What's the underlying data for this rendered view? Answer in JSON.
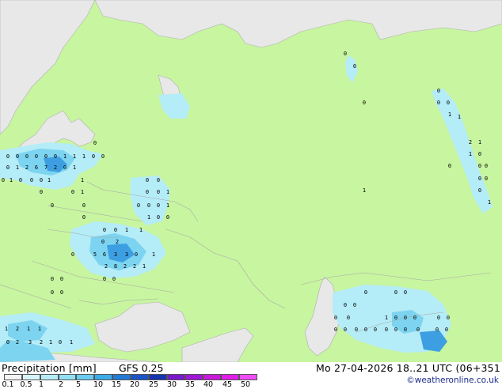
{
  "footer": {
    "title": "Precipitation [mm]",
    "model": "GFS 0.25",
    "valid": "Mo 27-04-2026 18..21 UTC (06+351",
    "credit": "©weatheronline.co.uk"
  },
  "legend": {
    "labels": [
      "0.1",
      "0.5",
      "1",
      "2",
      "5",
      "10",
      "15",
      "20",
      "25",
      "30",
      "35",
      "40",
      "45",
      "50"
    ],
    "colors": [
      "#f5f5f5",
      "#d8f6fa",
      "#b6ecf6",
      "#93e0f4",
      "#6ccdf0",
      "#3dabe6",
      "#247bd6",
      "#1a55c6",
      "#1635ae",
      "#7a19c9",
      "#9f18d8",
      "#c81ad8",
      "#e01ee8",
      "#f04cf5"
    ]
  },
  "colors": {
    "land": "#c8f5a0",
    "sea": "#e8e8e8",
    "border": "#a8a8a8",
    "rain_light": "#b4ecf7",
    "rain_mid": "#7cd4f0",
    "rain_heavy": "#3d9fe2"
  },
  "map_values": [
    "0",
    "0",
    "0",
    "0",
    "0",
    "0",
    "1",
    "1",
    "1",
    "0",
    "0",
    "0",
    "0",
    "1",
    "2",
    "6",
    "7",
    "2",
    "0",
    "1",
    "0",
    "1",
    "0",
    "0",
    "0",
    "1",
    "1",
    "0",
    "0",
    "1",
    "0",
    "0",
    "0",
    "0",
    "1",
    "0",
    "0",
    "1",
    "1",
    "0",
    "0",
    "0",
    "0",
    "0",
    "0",
    "0",
    "0",
    "0",
    "2",
    "1",
    "1",
    "5",
    "6",
    "3",
    "3",
    "0",
    "2",
    "8",
    "2",
    "2",
    "1",
    "0",
    "1",
    "0",
    "0",
    "0",
    "0",
    "0",
    "0",
    "1",
    "2",
    "1",
    "1",
    "0",
    "2",
    "3",
    "2",
    "1",
    "0",
    "1",
    "0",
    "0",
    "0",
    "0",
    "0",
    "0",
    "0",
    "1",
    "0",
    "0",
    "0",
    "0",
    "0",
    "0",
    "0",
    "0",
    "0",
    "0",
    "0",
    "0",
    "0",
    "0",
    "0",
    "0",
    "0",
    "0",
    "0",
    "0",
    "0",
    "0",
    "1",
    "1",
    "2",
    "1",
    "1",
    "0",
    "0",
    "0",
    "0",
    "0",
    "0",
    "0",
    "1",
    "1"
  ]
}
